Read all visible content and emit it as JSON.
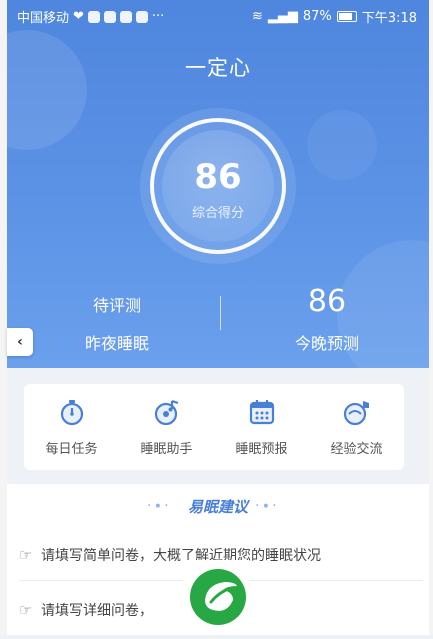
{
  "status_bar": {
    "carrier": "中国移动",
    "signal_extra": "···",
    "battery": "87%",
    "time": "下午3:18"
  },
  "app": {
    "title": "一定心"
  },
  "score": {
    "value": "86",
    "label": "综合得分"
  },
  "stats": {
    "left_value": "待评测",
    "left_label": "昨夜睡眠",
    "right_value": "86",
    "right_label": "今晚预测"
  },
  "tools": [
    {
      "label": "每日任务",
      "icon": "stopwatch-icon"
    },
    {
      "label": "睡眠助手",
      "icon": "music-disc-icon"
    },
    {
      "label": "睡眠预报",
      "icon": "calendar-icon"
    },
    {
      "label": "经验交流",
      "icon": "chat-bubble-icon"
    }
  ],
  "advice": {
    "title": "易眠建议",
    "items": [
      "请填写简单问卷，大概了解近期您的睡眠状况",
      "请填写详细问卷，"
    ]
  },
  "colors": {
    "hero_blue": "#5c93e6",
    "accent_blue": "#4a7fd8",
    "logo_green": "#27a844"
  }
}
